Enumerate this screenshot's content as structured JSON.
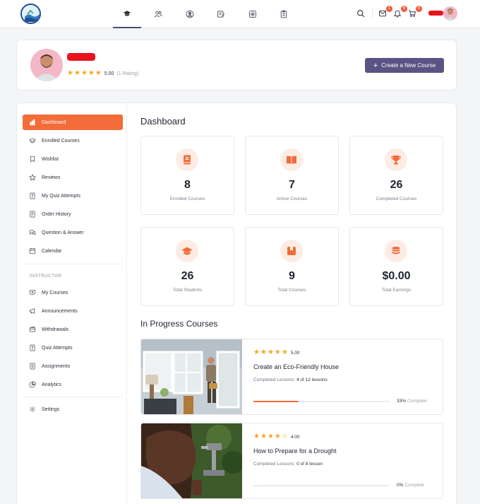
{
  "nav": {
    "icons": [
      "graduation-cap-icon",
      "users-icon",
      "user-circle-icon",
      "edit-note-icon",
      "target-icon",
      "clipboard-icon"
    ],
    "badges": {
      "messages": "1",
      "notifications": "9",
      "cart": "5"
    }
  },
  "profile": {
    "rating_value": "5.00",
    "rating_count": "(1 Rating)",
    "stars": 5,
    "create_button": "Create a New Course"
  },
  "sidebar": {
    "items": [
      {
        "label": "Dashboard",
        "icon": "dashboard-icon"
      },
      {
        "label": "Enrolled Courses",
        "icon": "graduation-cap-icon"
      },
      {
        "label": "Wishlist",
        "icon": "bookmark-icon"
      },
      {
        "label": "Reviews",
        "icon": "star-icon"
      },
      {
        "label": "My Quiz Attempts",
        "icon": "quiz-icon"
      },
      {
        "label": "Order History",
        "icon": "order-icon"
      },
      {
        "label": "Question & Answer",
        "icon": "chat-icon"
      },
      {
        "label": "Calendar",
        "icon": "calendar-icon"
      }
    ],
    "instructor_heading": "INSTRUCTOR",
    "instructor_items": [
      {
        "label": "My Courses",
        "icon": "course-icon"
      },
      {
        "label": "Announcements",
        "icon": "megaphone-icon"
      },
      {
        "label": "Withdrawals",
        "icon": "wallet-icon"
      },
      {
        "label": "Quiz Attempts",
        "icon": "quiz-icon"
      },
      {
        "label": "Assignments",
        "icon": "assignment-icon"
      },
      {
        "label": "Analytics",
        "icon": "chart-icon"
      }
    ],
    "settings": {
      "label": "Settings",
      "icon": "gear-icon"
    }
  },
  "dashboard": {
    "title": "Dashboard",
    "stats": [
      {
        "value": "8",
        "label": "Enrolled Courses",
        "icon": "book-icon"
      },
      {
        "value": "7",
        "label": "Active Courses",
        "icon": "open-book-icon"
      },
      {
        "value": "26",
        "label": "Completed Courses",
        "icon": "trophy-icon"
      },
      {
        "value": "26",
        "label": "Total Students",
        "icon": "graduation-cap-icon"
      },
      {
        "value": "9",
        "label": "Total Courses",
        "icon": "box-icon"
      },
      {
        "value": "$0.00",
        "label": "Total Earnings",
        "icon": "coins-icon"
      }
    ]
  },
  "in_progress": {
    "title": "In Progress Courses",
    "courses": [
      {
        "rating": "5.00",
        "stars": 5,
        "title": "Create an Eco-Friendly House",
        "lessons_label": "Completed Lessons:",
        "lessons_value": "4 of 12 lessons",
        "progress": 33,
        "pct_value": "33%",
        "pct_label": "Complete"
      },
      {
        "rating": "4.00",
        "stars": 4,
        "title": "How to Prepare for a Drought",
        "lessons_label": "Completed Lessons:",
        "lessons_value": "0 of 8 lesson",
        "progress": 0,
        "pct_value": "0%",
        "pct_label": "Complete"
      }
    ]
  },
  "colors": {
    "accent": "#f36c3a",
    "primary_button": "#5a5484",
    "star": "#f5a623",
    "icon_bg": "#fdece4"
  }
}
